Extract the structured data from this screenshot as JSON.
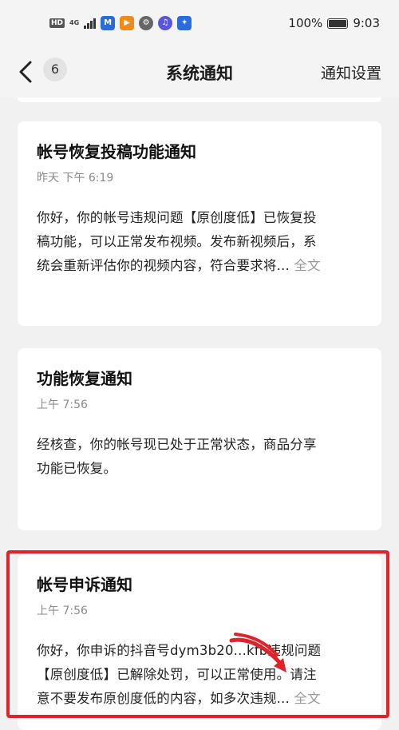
{
  "status_bar": {
    "network": "4G",
    "hd": "HD",
    "battery": "100%",
    "time": "9:03"
  },
  "nav": {
    "back_count": "6",
    "title": "系统通知",
    "settings": "通知设置"
  },
  "notifications": [
    {
      "title": "帐号恢复投稿功能通知",
      "time": "昨天 下午 6:19",
      "body_lines": [
        "你好，你的帐号违规问题【原创度低】已恢复投",
        "稿功能，可以正常发布视频。发布新视频后，系",
        "统会重新评估你的视频内容，符合要求将..."
      ],
      "more": "全文"
    },
    {
      "title": "功能恢复通知",
      "time": "上午 7:56",
      "body_lines": [
        "经核查，你的帐号现已处于正常状态，商品分享",
        "功能已恢复。"
      ]
    },
    {
      "title": "帐号申诉通知",
      "time": "上午 7:56",
      "body_lines": [
        "你好，你申诉的抖音号dym3b20...kfb违规问题",
        "【原创度低】已解除处罚，可以正常使用。请注",
        "意不要发布原创度低的内容，如多次违规..."
      ],
      "more": "全文"
    }
  ],
  "colors": {
    "highlight": "#e0222a",
    "background": "#f1f1f1"
  }
}
